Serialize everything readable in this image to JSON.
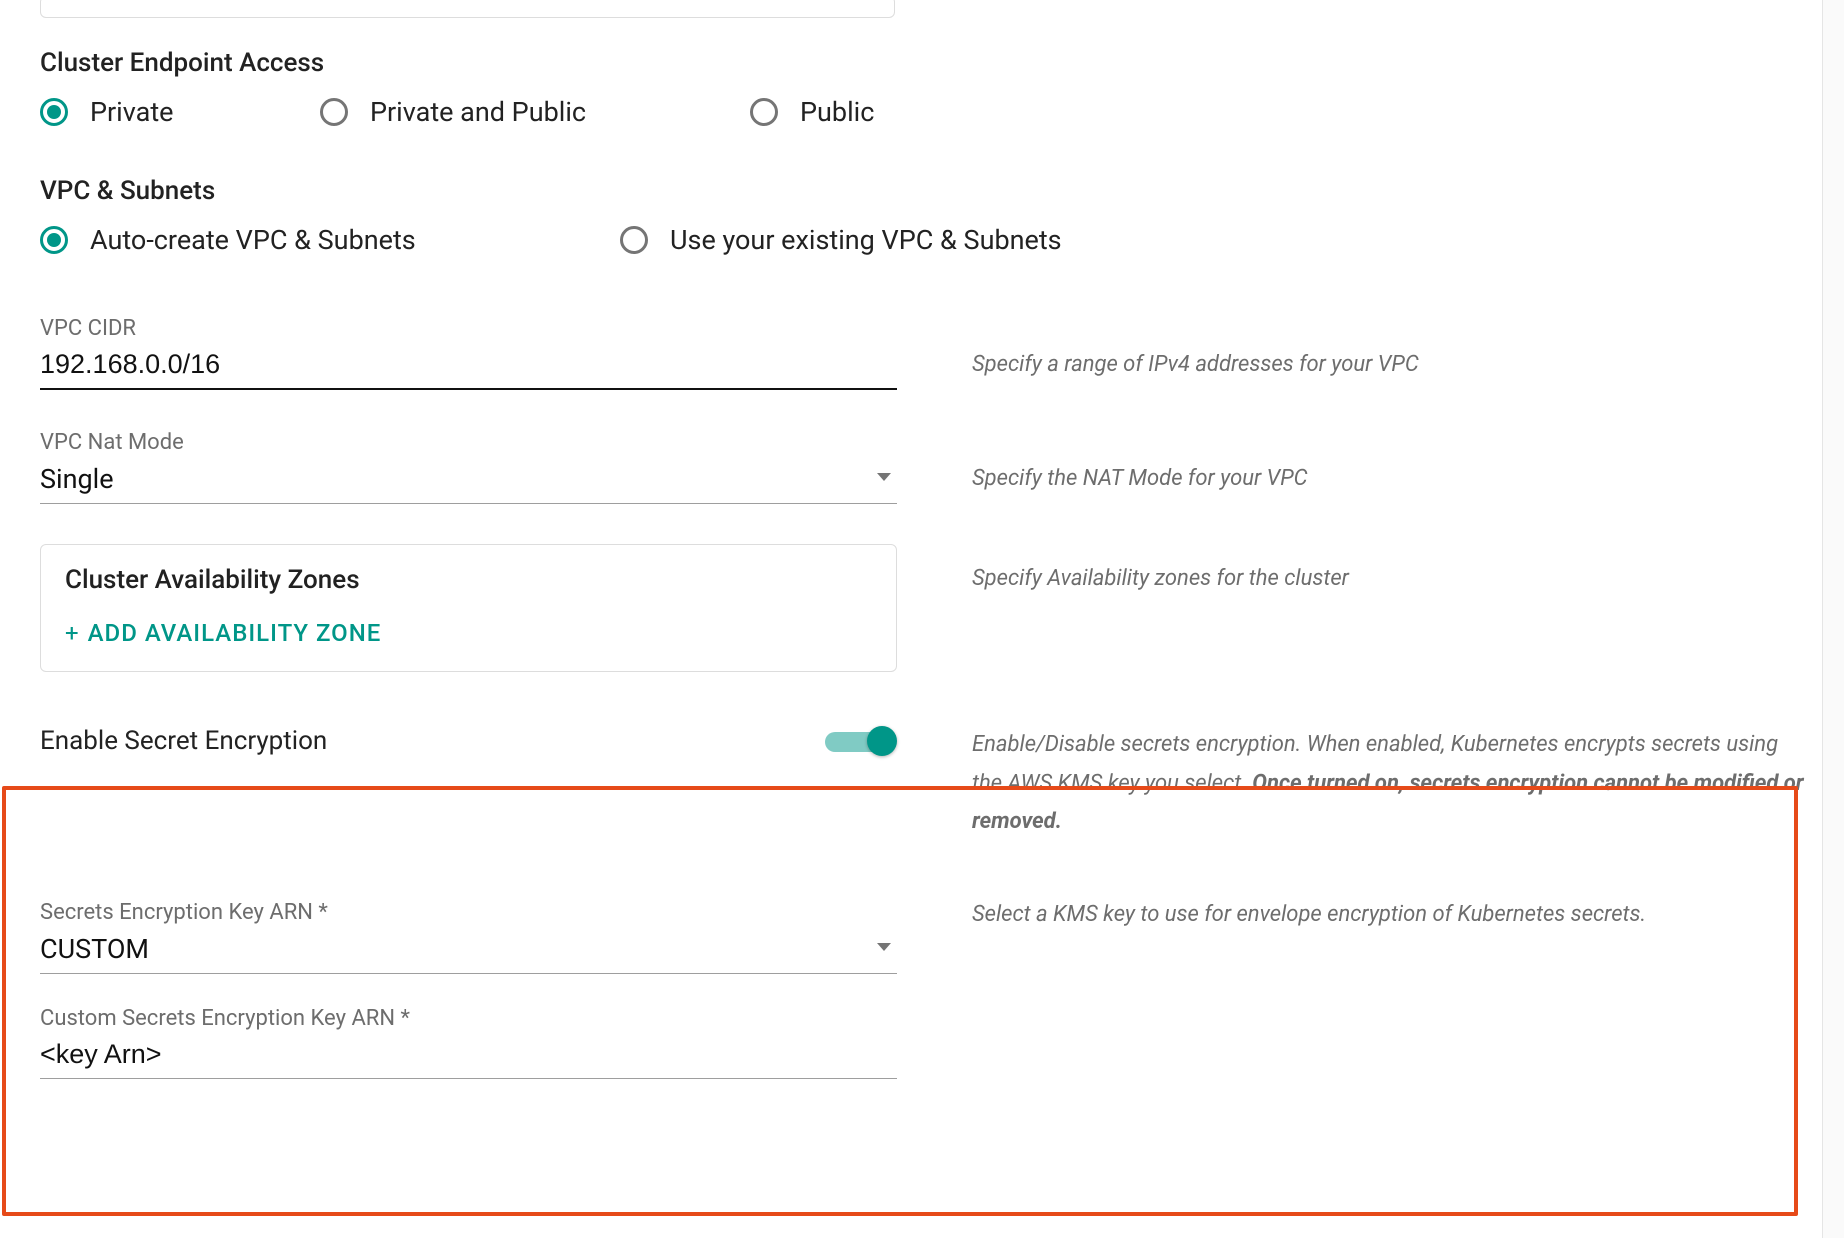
{
  "endpoint": {
    "heading": "Cluster Endpoint Access",
    "options": {
      "private": "Private",
      "private_public": "Private and Public",
      "public": "Public"
    }
  },
  "vpc_subnets": {
    "heading": "VPC & Subnets",
    "options": {
      "auto": "Auto-create VPC & Subnets",
      "existing": "Use your existing VPC & Subnets"
    }
  },
  "vpc_cidr": {
    "label": "VPC CIDR",
    "value": "192.168.0.0/16",
    "helper": "Specify a range of IPv4 addresses for your VPC"
  },
  "vpc_nat": {
    "label": "VPC Nat Mode",
    "value": "Single",
    "helper": "Specify the NAT Mode for your VPC"
  },
  "az": {
    "title": "Cluster Availability Zones",
    "add_label": "ADD  AVAILABILITY ZONE",
    "helper": "Specify Availability zones for the cluster"
  },
  "secret": {
    "toggle_label": "Enable Secret Encryption",
    "helper_a": "Enable/Disable secrets encryption. When enabled, Kubernetes encrypts secrets using the AWS KMS key you select. ",
    "helper_b": "Once turned on, secrets encryption cannot be modified or removed.",
    "key_arn": {
      "label": "Secrets Encryption Key ARN *",
      "value": "CUSTOM",
      "helper": "Select a KMS key to use for envelope encryption of Kubernetes secrets."
    },
    "custom_arn": {
      "label": "Custom Secrets Encryption Key ARN *",
      "value": "<key Arn>"
    }
  }
}
